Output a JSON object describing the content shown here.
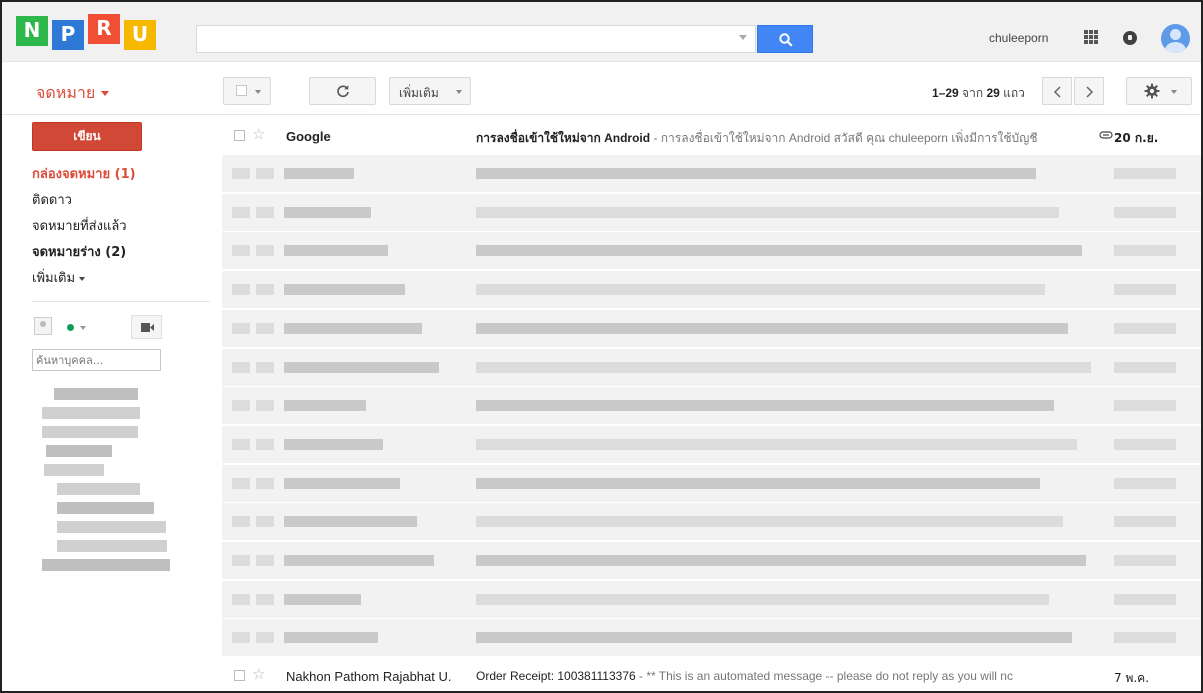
{
  "header": {
    "logo_letters": [
      {
        "char": "N",
        "color": "#2eb84b"
      },
      {
        "char": "P",
        "color": "#2e78d6"
      },
      {
        "char": "R",
        "color": "#f04e35"
      },
      {
        "char": "U",
        "color": "#f7b800"
      }
    ],
    "search": {
      "value": "",
      "placeholder": ""
    },
    "username": "chuleeporn",
    "accent": "#4285f4"
  },
  "toolbar": {
    "mail_label": "จดหมาย",
    "more_label": "เพิ่มเติม",
    "pager_range": "1–29",
    "pager_of": "จาก",
    "pager_total": "29",
    "pager_unit": "แถว"
  },
  "sidebar": {
    "compose_label": "เขียน",
    "items": [
      {
        "label": "กล่องจดหมาย (1)",
        "state": "active"
      },
      {
        "label": "ติดดาว",
        "state": "normal"
      },
      {
        "label": "จดหมายที่ส่งแล้ว",
        "state": "normal"
      },
      {
        "label": "จดหมายร่าง (2)",
        "state": "bold"
      },
      {
        "label": "เพิ่มเติม",
        "state": "more"
      }
    ],
    "people_search_placeholder": "ค้นหาบุคคล..."
  },
  "messages": {
    "first": {
      "sender": "Google",
      "subject": "การลงชื่อเข้าใช้ใหม่จาก Android",
      "snippet": " - การลงชื่อเข้าใช้ใหม่จาก Android สวัสดี คุณ chuleeporn เพิ่งมีการใช้บัญชี",
      "date": "20 ก.ย.",
      "unread": true
    },
    "last": {
      "sender": "Nakhon Pathom Rajabhat U.",
      "subject": "Order Receipt: 100381113376",
      "snippet": " - ** This is an automated message -- please do not reply as you will nc",
      "date": "7 พ.ค.",
      "unread": false
    },
    "blurred_rows": 13
  }
}
